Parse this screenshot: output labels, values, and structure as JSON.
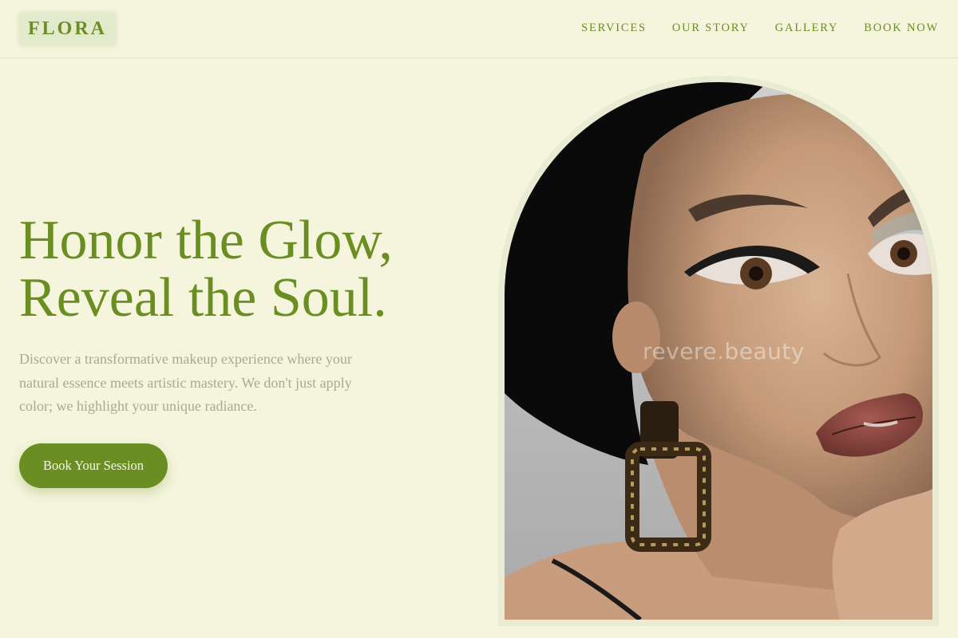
{
  "brand": {
    "name": "FLORA"
  },
  "nav": {
    "items": [
      {
        "label": "SERVICES"
      },
      {
        "label": "OUR STORY"
      },
      {
        "label": "GALLERY"
      },
      {
        "label": "BOOK NOW"
      }
    ]
  },
  "hero": {
    "headline_line1": "Honor the Glow,",
    "headline_line2": "Reveal the Soul.",
    "description": "Discover a transformative makeup experience where your natural essence meets artistic mastery. We don't just apply color; we highlight your unique radiance.",
    "cta_label": "Book Your Session",
    "image_watermark": "revere.beauty"
  },
  "colors": {
    "background": "#f4f5dc",
    "accent": "#6b8e23",
    "muted_text": "#aaa98f"
  }
}
